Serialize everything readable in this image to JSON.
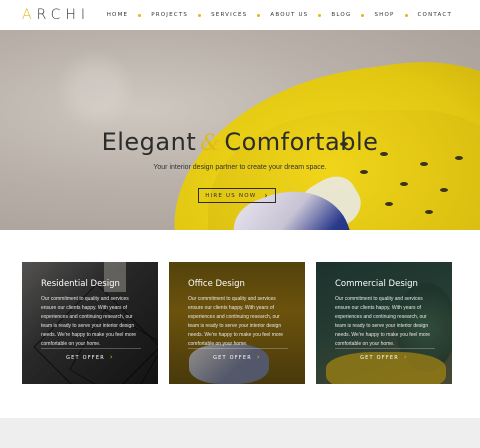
{
  "brand": {
    "logo_first": "A",
    "logo_rest": "RCHI",
    "accent": "#e0b81e"
  },
  "nav": {
    "items": [
      {
        "label": "HOME"
      },
      {
        "label": "PROJECTS"
      },
      {
        "label": "SERVICES"
      },
      {
        "label": "ABOUT US"
      },
      {
        "label": "BLOG"
      },
      {
        "label": "SHOP"
      },
      {
        "label": "CONTACT"
      }
    ]
  },
  "hero": {
    "title_left": "Elegant",
    "title_amp": "&",
    "title_right": "Comfortable",
    "subtitle": "Your interior design partner to create your dream space.",
    "cta": "HIRE US NOW",
    "cta_icon": "chevron-right-icon"
  },
  "cards": [
    {
      "title": "Residential Design",
      "body": "Our commitment to quality and services ensure our clients happy. With years of experiences and continuing research, our team is ready to serve your interior design needs. We're happy to make you feel more comfortable on your home.",
      "cta": "GET OFFER"
    },
    {
      "title": "Office Design",
      "body": "Our commitment to quality and services ensure our clients happy. With years of experiences and continuing research, our team is ready to serve your interior design needs. We're happy to make you feel more comfortable on your home.",
      "cta": "GET OFFER"
    },
    {
      "title": "Commercial Design",
      "body": "Our commitment to quality and services ensure our clients happy. With years of experiences and continuing research, our team is ready to serve your interior design needs. We're happy to make you feel more comfortable on your home.",
      "cta": "GET OFFER"
    }
  ]
}
